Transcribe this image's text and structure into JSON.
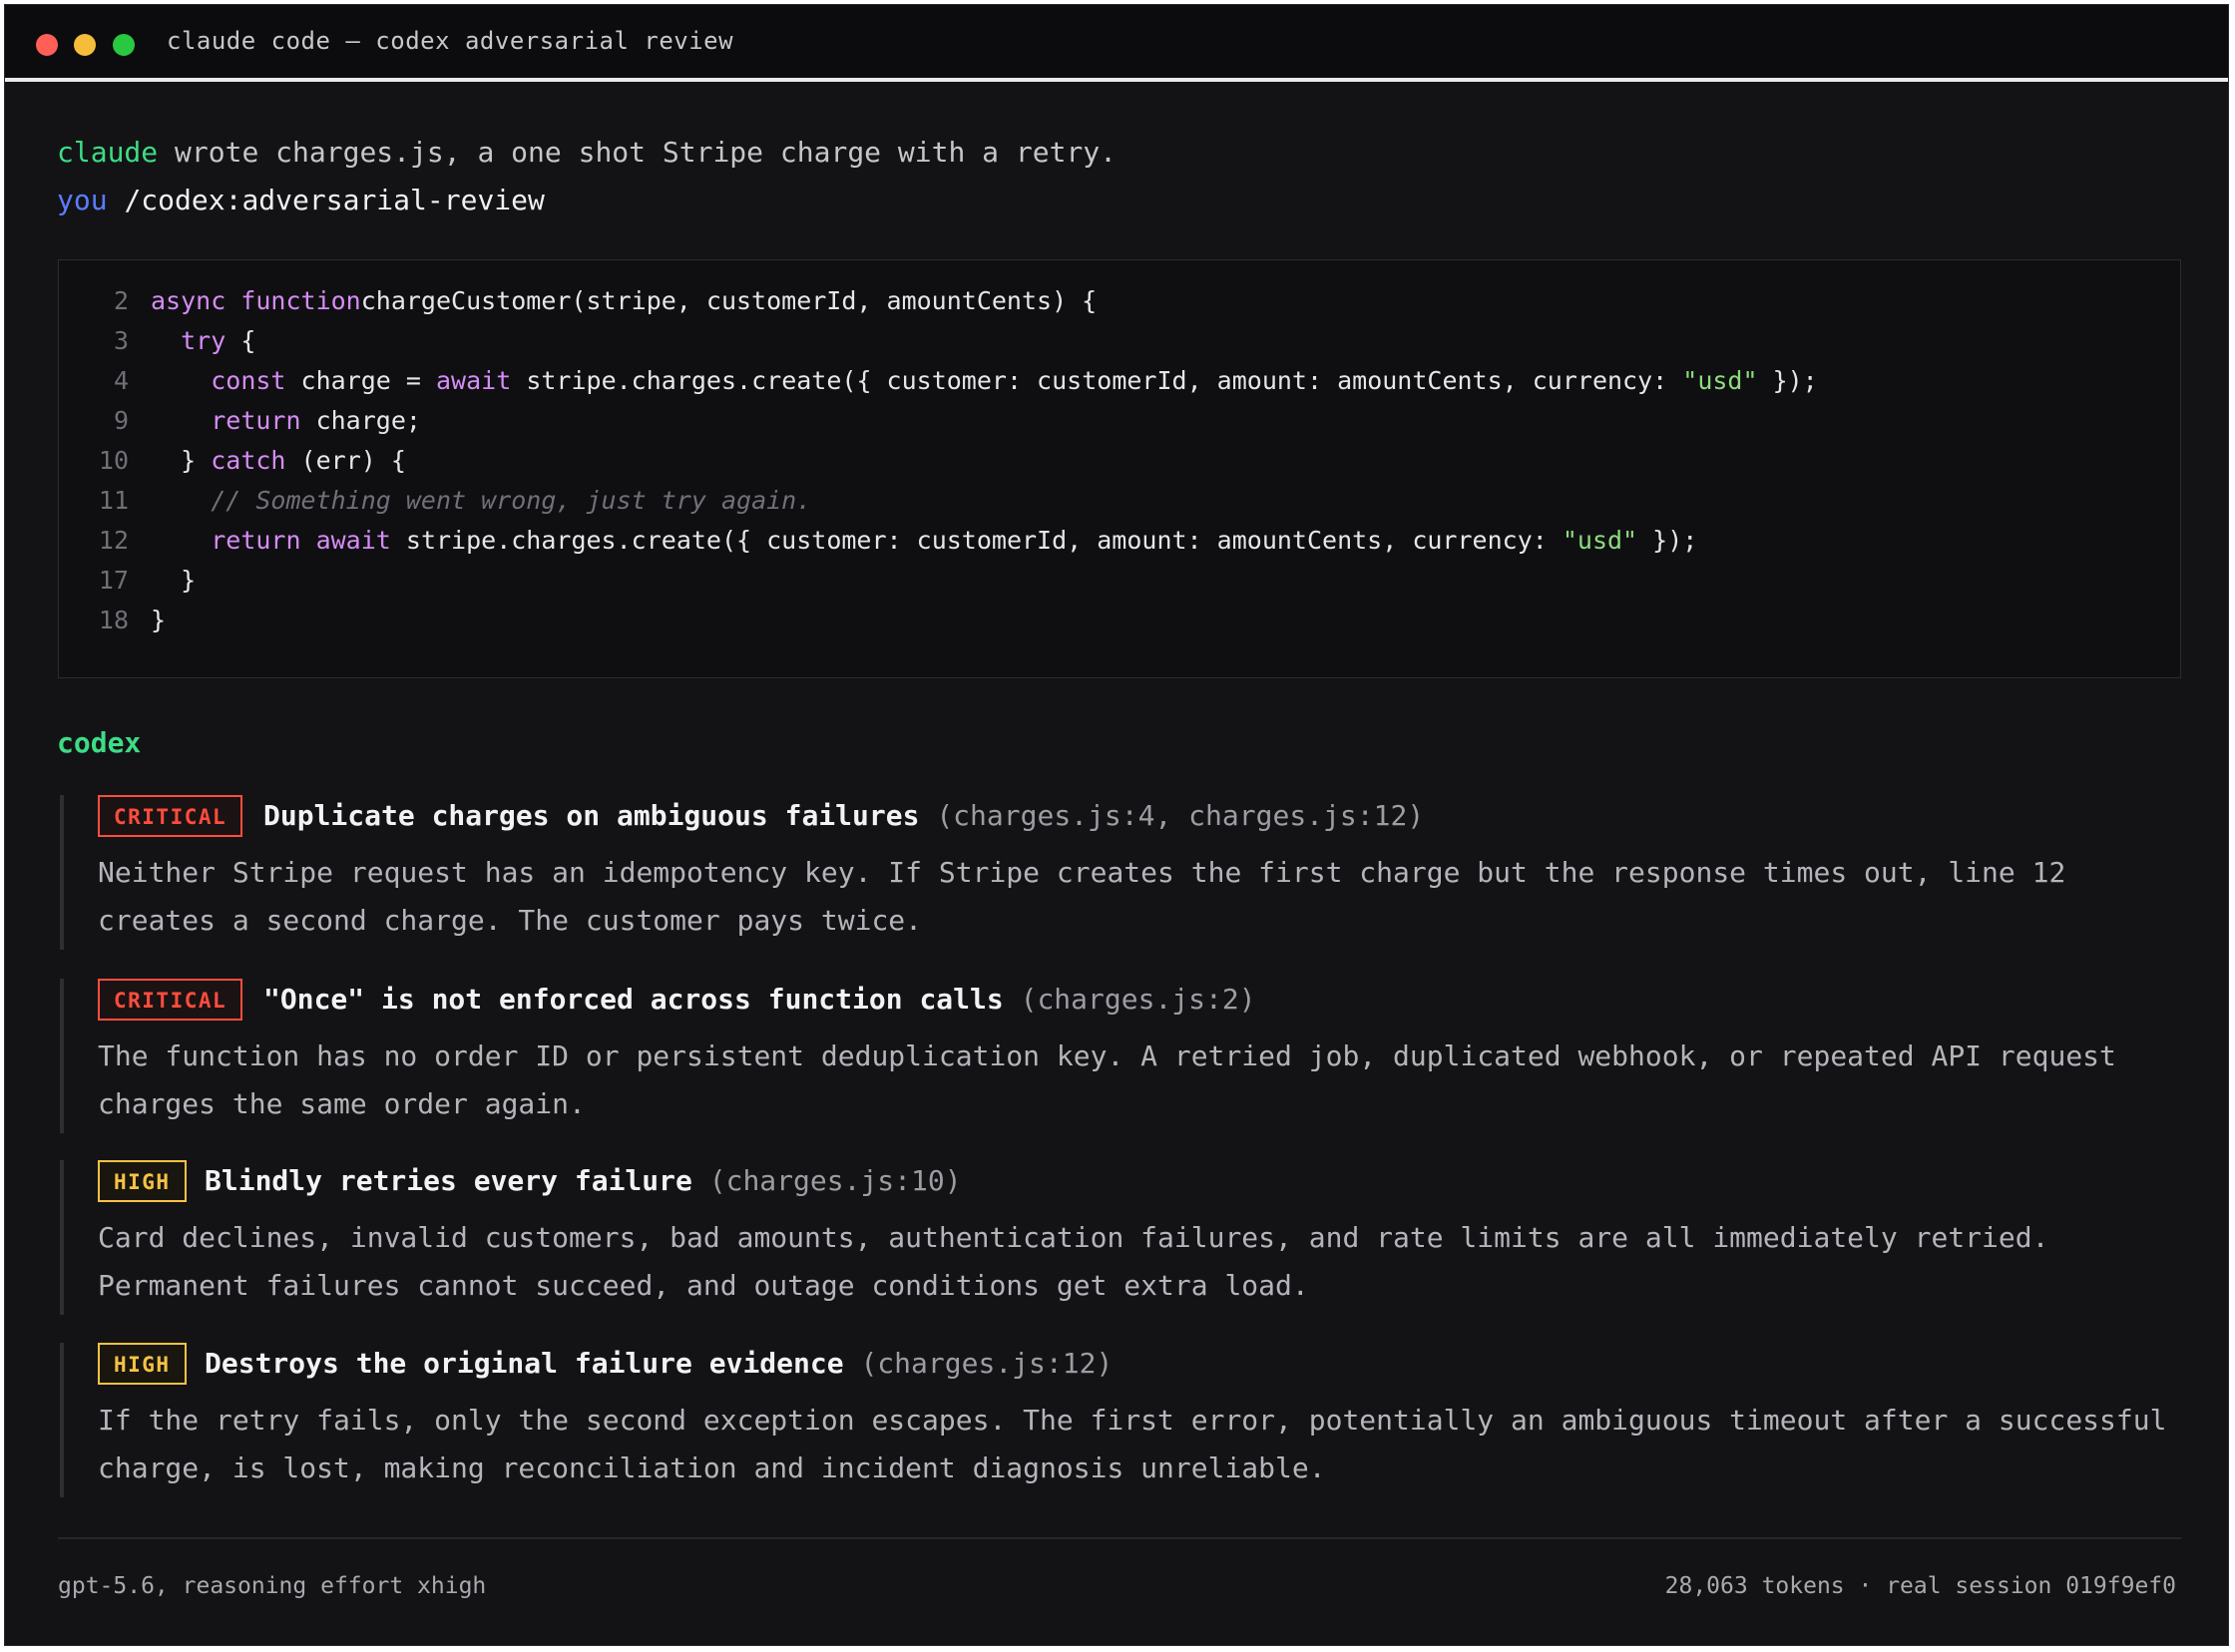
{
  "window": {
    "title": "claude code — codex adversarial review"
  },
  "conversation": {
    "claude_label": "claude",
    "claude_message": "wrote charges.js, a one shot Stripe charge with a retry.",
    "you_label": "you",
    "you_command": "/codex:adversarial-review"
  },
  "code": {
    "lines": [
      {
        "num": "2",
        "tokens": [
          [
            "kw",
            "async function"
          ],
          [
            "",
            "chargeCustomer(stripe, customerId, amountCents) {"
          ]
        ]
      },
      {
        "num": "3",
        "tokens": [
          [
            "",
            "  "
          ],
          [
            "kw",
            "try"
          ],
          [
            "",
            " {"
          ]
        ]
      },
      {
        "num": "4",
        "tokens": [
          [
            "",
            "    "
          ],
          [
            "kw",
            "const"
          ],
          [
            "",
            " charge = "
          ],
          [
            "kw",
            "await"
          ],
          [
            "",
            " stripe.charges.create({ customer: customerId, amount: amountCents, currency: "
          ],
          [
            "str",
            "\"usd\""
          ],
          [
            "",
            " });"
          ]
        ]
      },
      {
        "num": "9",
        "tokens": [
          [
            "",
            "    "
          ],
          [
            "kw",
            "return"
          ],
          [
            "",
            " charge;"
          ]
        ]
      },
      {
        "num": "10",
        "tokens": [
          [
            "",
            "  } "
          ],
          [
            "kw",
            "catch"
          ],
          [
            "",
            " (err) {"
          ]
        ]
      },
      {
        "num": "11",
        "tokens": [
          [
            "",
            "    "
          ],
          [
            "cm",
            "// Something went wrong, just try again."
          ]
        ]
      },
      {
        "num": "12",
        "tokens": [
          [
            "",
            "    "
          ],
          [
            "kw",
            "return await"
          ],
          [
            "",
            " stripe.charges.create({ customer: customerId, amount: amountCents, currency: "
          ],
          [
            "str",
            "\"usd\""
          ],
          [
            "",
            " });"
          ]
        ]
      },
      {
        "num": "17",
        "tokens": [
          [
            "",
            "  }"
          ]
        ]
      },
      {
        "num": "18",
        "tokens": [
          [
            "",
            "}"
          ]
        ]
      }
    ]
  },
  "codex": {
    "label": "codex",
    "findings": [
      {
        "severity": "CRITICAL",
        "title": "Duplicate charges on ambiguous failures",
        "ref": "(charges.js:4, charges.js:12)",
        "body": "Neither Stripe request has an idempotency key. If Stripe creates the first charge but the response times out, line 12 creates a second charge. The customer pays twice."
      },
      {
        "severity": "CRITICAL",
        "title": "\"Once\" is not enforced across function calls",
        "ref": "(charges.js:2)",
        "body": "The function has no order ID or persistent deduplication key. A retried job, duplicated webhook, or repeated API request charges the same order again."
      },
      {
        "severity": "HIGH",
        "title": "Blindly retries every failure",
        "ref": "(charges.js:10)",
        "body": "Card declines, invalid customers, bad amounts, authentication failures, and rate limits are all immediately retried. Permanent failures cannot succeed, and outage conditions get extra load."
      },
      {
        "severity": "HIGH",
        "title": "Destroys the original failure evidence",
        "ref": "(charges.js:12)",
        "body": "If the retry fails, only the second exception escapes. The first error, potentially an ambiguous timeout after a successful charge, is lost, making reconciliation and incident diagnosis unreliable."
      }
    ]
  },
  "footer": {
    "model": "gpt-5.6, reasoning effort xhigh",
    "session": "28,063 tokens · real session 019f9ef0"
  },
  "colors": {
    "background": "#131316",
    "claude": "#3ddc84",
    "you": "#5b7cff",
    "critical": "#ff4d3d",
    "high": "#f6c244",
    "keyword": "#d58cf5",
    "string": "#8edc7d"
  },
  "icons": [
    "close-dot",
    "minimize-dot",
    "zoom-dot"
  ]
}
